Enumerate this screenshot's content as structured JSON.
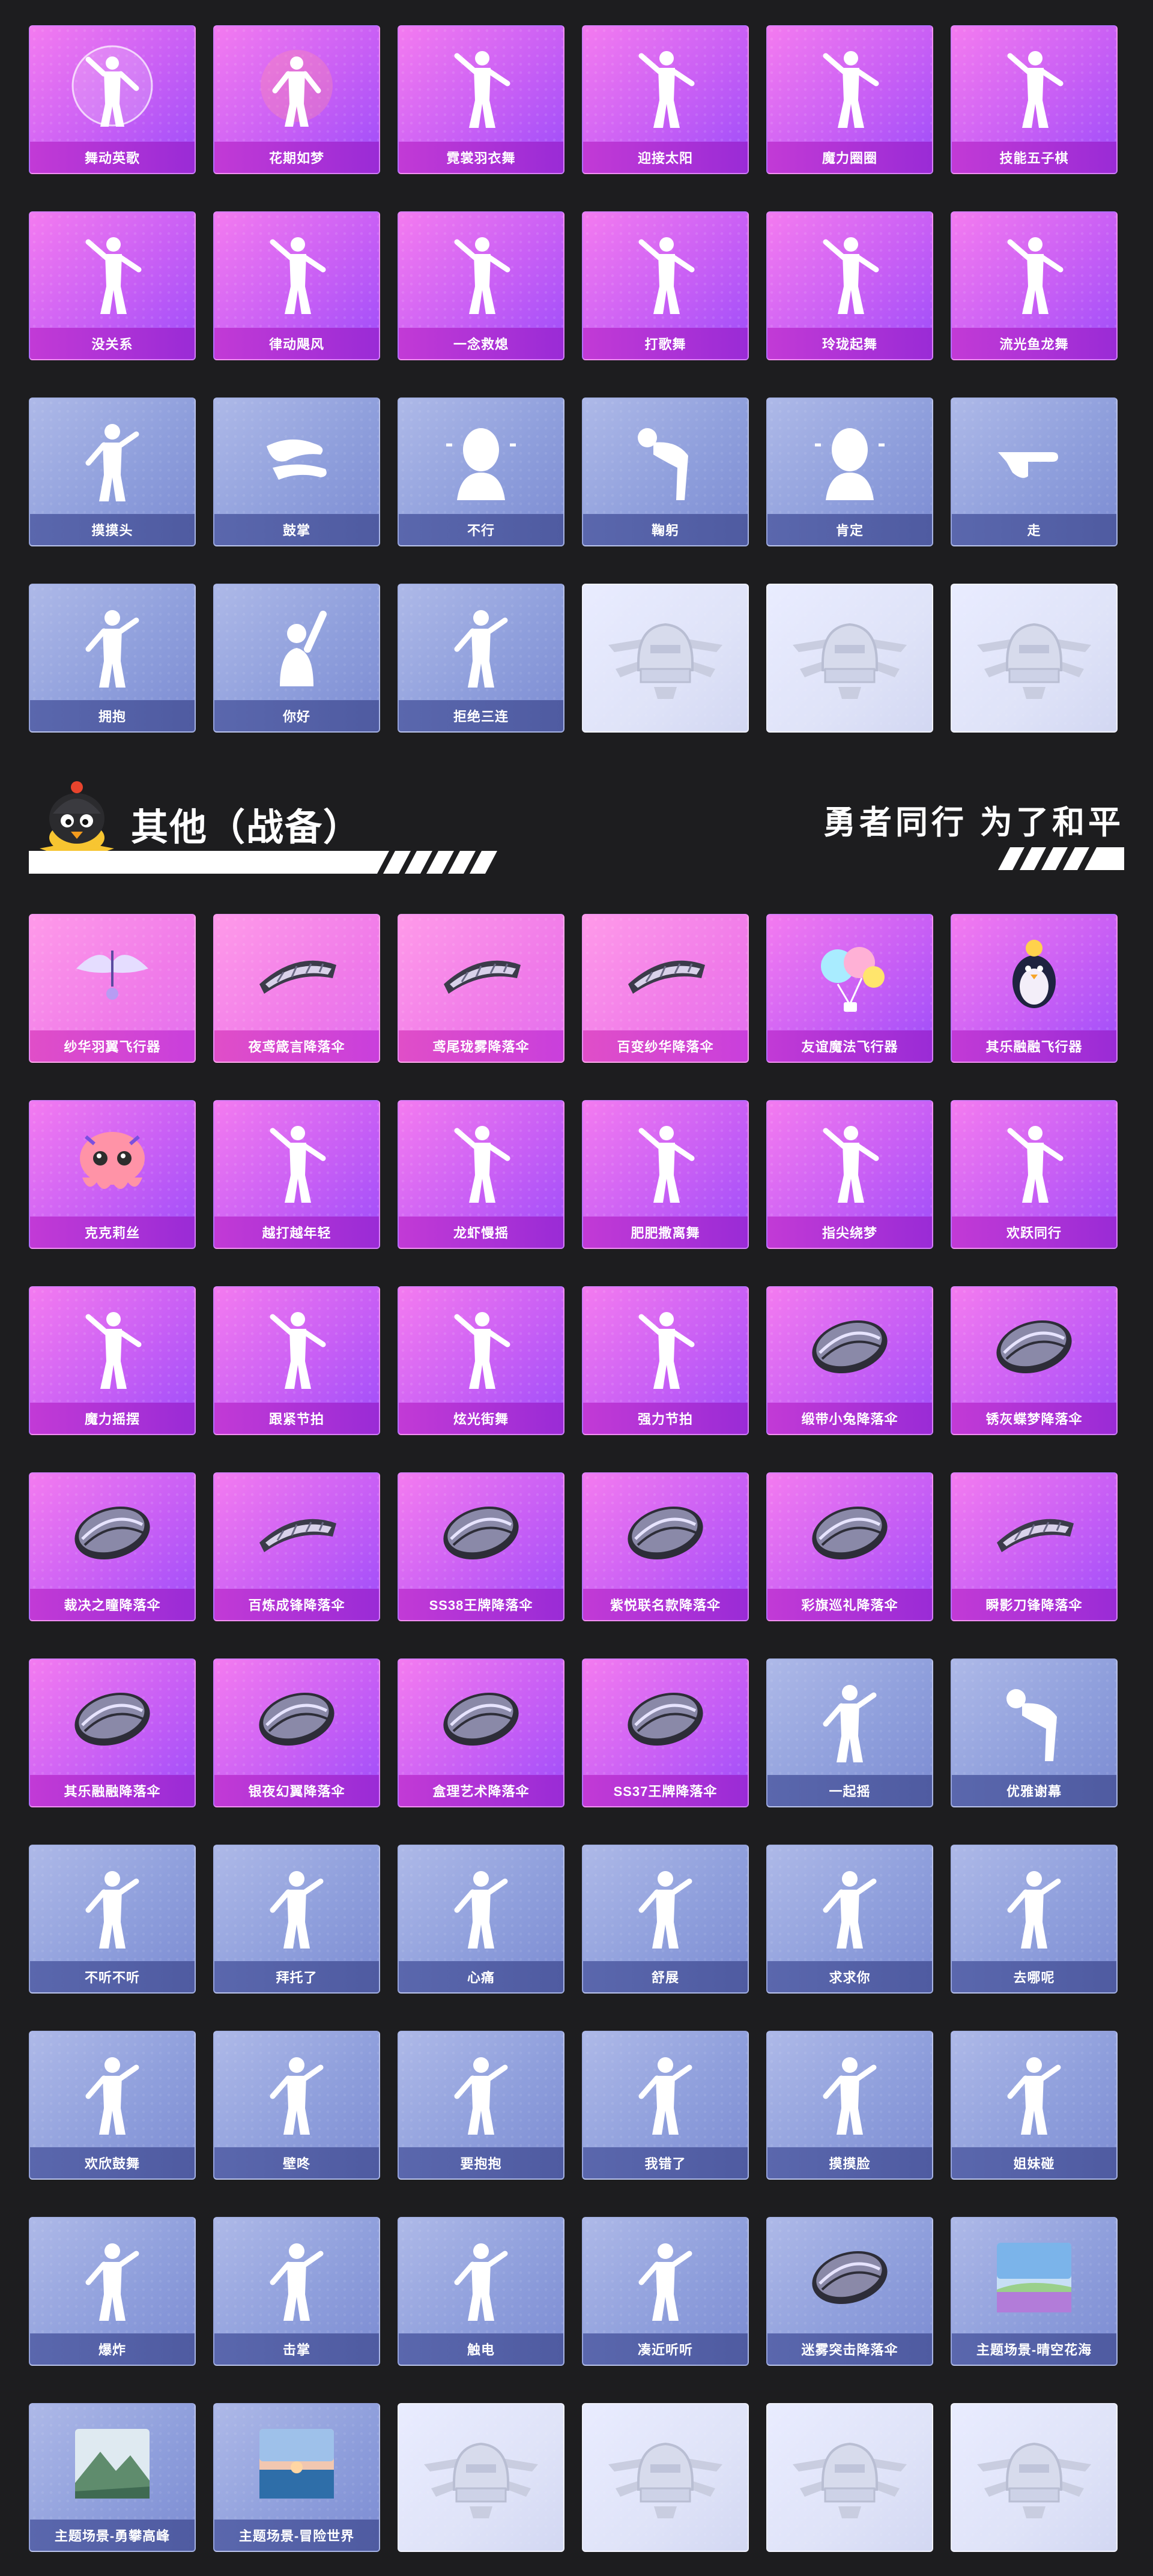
{
  "emotes": [
    {
      "label": "舞动英歌",
      "style": "purple",
      "icon": "bubble-dancer-icon"
    },
    {
      "label": "花期如梦",
      "style": "purple",
      "icon": "flower-dancer-icon"
    },
    {
      "label": "霓裳羽衣舞",
      "style": "purple",
      "icon": "dancer-icon"
    },
    {
      "label": "迎接太阳",
      "style": "purple",
      "icon": "dancer-icon"
    },
    {
      "label": "魔力圈圈",
      "style": "purple",
      "icon": "dancer-icon"
    },
    {
      "label": "技能五子棋",
      "style": "purple",
      "icon": "dancer-icon"
    },
    {
      "label": "没关系",
      "style": "purple",
      "icon": "dancer-icon"
    },
    {
      "label": "律动飓风",
      "style": "purple",
      "icon": "dancer-icon"
    },
    {
      "label": "一念救熄",
      "style": "purple",
      "icon": "dancer-icon"
    },
    {
      "label": "打歌舞",
      "style": "purple",
      "icon": "dancer-icon"
    },
    {
      "label": "玲珑起舞",
      "style": "purple",
      "icon": "dancer-icon"
    },
    {
      "label": "流光鱼龙舞",
      "style": "purple",
      "icon": "dancer-icon"
    },
    {
      "label": "摸摸头",
      "style": "blue",
      "icon": "gesture-icon"
    },
    {
      "label": "鼓掌",
      "style": "blue",
      "icon": "clap-icon"
    },
    {
      "label": "不行",
      "style": "blue",
      "icon": "head-shake-icon"
    },
    {
      "label": "鞠躬",
      "style": "blue",
      "icon": "bow-icon"
    },
    {
      "label": "肯定",
      "style": "blue",
      "icon": "nod-icon"
    },
    {
      "label": "走",
      "style": "blue",
      "icon": "point-icon"
    },
    {
      "label": "拥抱",
      "style": "blue",
      "icon": "gesture-icon"
    },
    {
      "label": "你好",
      "style": "blue",
      "icon": "wave-icon"
    },
    {
      "label": "拒绝三连",
      "style": "blue",
      "icon": "gesture-icon"
    },
    {
      "label": "",
      "style": "empty",
      "icon": "pubg-helmet-emblem-icon"
    },
    {
      "label": "",
      "style": "empty",
      "icon": "pubg-helmet-emblem-icon"
    },
    {
      "label": "",
      "style": "empty",
      "icon": "pubg-helmet-emblem-icon"
    }
  ],
  "section": {
    "title": "其他（战备）",
    "tagline": "勇者同行 为了和平",
    "mascot_icon": "chicken-mascot-icon"
  },
  "others": [
    {
      "label": "纱华羽翼飞行器",
      "style": "pink",
      "icon": "glider-icon"
    },
    {
      "label": "夜鸢箴言降落伞",
      "style": "pink",
      "icon": "parachute-wing-icon"
    },
    {
      "label": "鸢尾珑雾降落伞",
      "style": "pink",
      "icon": "parachute-wing-icon"
    },
    {
      "label": "百变纱华降落伞",
      "style": "pink",
      "icon": "parachute-wing-icon"
    },
    {
      "label": "友谊魔法飞行器",
      "style": "purple",
      "icon": "balloon-glider-icon"
    },
    {
      "label": "其乐融融飞行器",
      "style": "purple",
      "icon": "penguin-glider-icon"
    },
    {
      "label": "克克莉丝",
      "style": "purple",
      "icon": "octopus-icon"
    },
    {
      "label": "越打越年轻",
      "style": "purple",
      "icon": "dancer-icon"
    },
    {
      "label": "龙虾慢摇",
      "style": "purple",
      "icon": "dancer-icon"
    },
    {
      "label": "肥肥撒离舞",
      "style": "purple",
      "icon": "dancer-icon"
    },
    {
      "label": "指尖绕梦",
      "style": "purple",
      "icon": "dancer-icon"
    },
    {
      "label": "欢跃同行",
      "style": "purple",
      "icon": "dancer-icon"
    },
    {
      "label": "魔力摇摆",
      "style": "purple",
      "icon": "dancer-icon"
    },
    {
      "label": "跟紧节拍",
      "style": "purple",
      "icon": "dancer-icon"
    },
    {
      "label": "炫光街舞",
      "style": "purple",
      "icon": "dancer-icon"
    },
    {
      "label": "强力节拍",
      "style": "purple",
      "icon": "dancer-icon"
    },
    {
      "label": "缎带小兔降落伞",
      "style": "purple",
      "icon": "parachute-round-icon"
    },
    {
      "label": "锈灰蝶梦降落伞",
      "style": "purple",
      "icon": "parachute-round-icon"
    },
    {
      "label": "裁决之瞳降落伞",
      "style": "purple",
      "icon": "parachute-round-icon"
    },
    {
      "label": "百炼成锋降落伞",
      "style": "purple",
      "icon": "parachute-wing-icon"
    },
    {
      "label": "SS38王牌降落伞",
      "style": "purple",
      "icon": "parachute-canopy-icon"
    },
    {
      "label": "紫悦联名款降落伞",
      "style": "purple",
      "icon": "parachute-canopy-icon"
    },
    {
      "label": "彩旗巡礼降落伞",
      "style": "purple",
      "icon": "parachute-round-icon"
    },
    {
      "label": "瞬影刀锋降落伞",
      "style": "purple",
      "icon": "parachute-wing-icon"
    },
    {
      "label": "其乐融融降落伞",
      "style": "purple",
      "icon": "parachute-canopy-icon"
    },
    {
      "label": "银夜幻翼降落伞",
      "style": "purple",
      "icon": "parachute-canopy-icon"
    },
    {
      "label": "盒理艺术降落伞",
      "style": "purple",
      "icon": "parachute-canopy-icon"
    },
    {
      "label": "SS37王牌降落伞",
      "style": "purple",
      "icon": "parachute-canopy-icon"
    },
    {
      "label": "一起摇",
      "style": "blue",
      "icon": "gesture-icon"
    },
    {
      "label": "优雅谢幕",
      "style": "blue",
      "icon": "bow-icon"
    },
    {
      "label": "不听不听",
      "style": "blue",
      "icon": "gesture-icon"
    },
    {
      "label": "拜托了",
      "style": "blue",
      "icon": "gesture-icon"
    },
    {
      "label": "心痛",
      "style": "blue",
      "icon": "gesture-icon"
    },
    {
      "label": "舒展",
      "style": "blue",
      "icon": "gesture-icon"
    },
    {
      "label": "求求你",
      "style": "blue",
      "icon": "gesture-icon"
    },
    {
      "label": "去哪呢",
      "style": "blue",
      "icon": "gesture-icon"
    },
    {
      "label": "欢欣鼓舞",
      "style": "blue",
      "icon": "gesture-icon"
    },
    {
      "label": "壁咚",
      "style": "blue",
      "icon": "gesture-icon"
    },
    {
      "label": "要抱抱",
      "style": "blue",
      "icon": "gesture-icon"
    },
    {
      "label": "我错了",
      "style": "blue",
      "icon": "gesture-icon"
    },
    {
      "label": "摸摸脸",
      "style": "blue",
      "icon": "gesture-icon"
    },
    {
      "label": "姐妹碰",
      "style": "blue",
      "icon": "gesture-icon"
    },
    {
      "label": "爆炸",
      "style": "blue",
      "icon": "gesture-icon"
    },
    {
      "label": "击掌",
      "style": "blue",
      "icon": "gesture-icon"
    },
    {
      "label": "触电",
      "style": "blue",
      "icon": "gesture-icon"
    },
    {
      "label": "凑近听听",
      "style": "blue",
      "icon": "gesture-icon"
    },
    {
      "label": "迷雾突击降落伞",
      "style": "blue",
      "icon": "parachute-canopy-icon"
    },
    {
      "label": "主题场景-晴空花海",
      "style": "blue",
      "icon": "scene-landscape-icon"
    },
    {
      "label": "主题场景-勇攀高峰",
      "style": "blue",
      "icon": "scene-mountain-icon"
    },
    {
      "label": "主题场景-冒险世界",
      "style": "blue",
      "icon": "scene-sea-icon"
    },
    {
      "label": "",
      "style": "empty",
      "icon": "pubg-helmet-emblem-icon"
    },
    {
      "label": "",
      "style": "empty",
      "icon": "pubg-helmet-emblem-icon"
    },
    {
      "label": "",
      "style": "empty",
      "icon": "pubg-helmet-emblem-icon"
    },
    {
      "label": "",
      "style": "empty",
      "icon": "pubg-helmet-emblem-icon"
    }
  ]
}
